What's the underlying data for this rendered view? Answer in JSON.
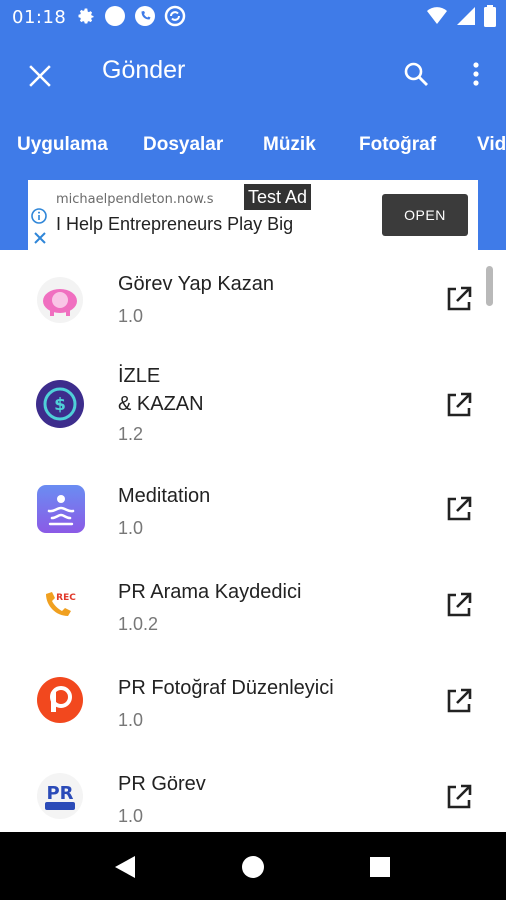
{
  "status_bar": {
    "time": "01:18",
    "left_icons": [
      "settings-icon",
      "circle-icon",
      "phone-icon",
      "sync-icon"
    ],
    "right_icons": [
      "wifi-icon",
      "signal-icon",
      "battery-icon"
    ]
  },
  "toolbar": {
    "title": "Gönder",
    "close_icon": "close-icon",
    "search_icon": "search-icon",
    "more_icon": "more-vert-icon",
    "background": "#3f7be8"
  },
  "tabs": [
    "Uygulama",
    "Dosyalar",
    "Müzik",
    "Fotoğraf",
    "Vid"
  ],
  "ad": {
    "badge": "Test Ad",
    "url": "michaelpendleton.now.s",
    "headline": "I Help Entrepreneurs Play Big",
    "cta": "OPEN"
  },
  "apps": [
    {
      "name": "Görev Yap Kazan",
      "version": "1.0",
      "icon": "piggy-bank-icon"
    },
    {
      "name": "İZLE\n& KAZAN",
      "version": "1.2",
      "icon": "dollar-coin-icon"
    },
    {
      "name": "Meditation",
      "version": "1.0",
      "icon": "meditation-icon"
    },
    {
      "name": "PR Arama Kaydedici",
      "version": "1.0.2",
      "icon": "call-recorder-icon"
    },
    {
      "name": "PR Fotoğraf Düzenleyici",
      "version": "1.0",
      "icon": "photo-editor-icon"
    },
    {
      "name": "PR Görev",
      "version": "1.0",
      "icon": "pr-gorev-icon"
    }
  ],
  "nav_bar": {
    "back": "back-icon",
    "home": "home-icon",
    "recents": "recents-icon"
  }
}
